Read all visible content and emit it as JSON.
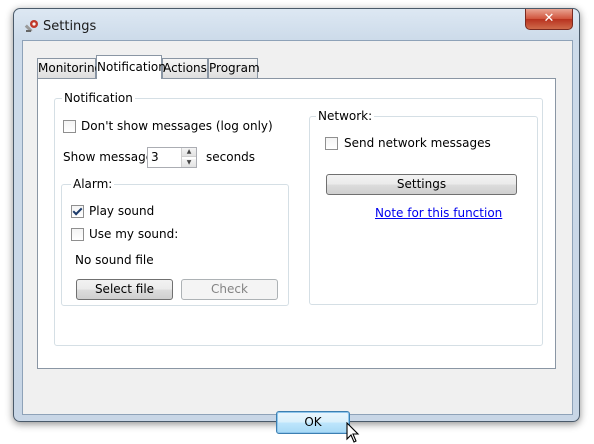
{
  "window": {
    "title": "Settings",
    "close_glyph": "✕"
  },
  "tabs": [
    {
      "label": "Monitoring",
      "active": false
    },
    {
      "label": "Notification",
      "active": true
    },
    {
      "label": "Actions",
      "active": false
    },
    {
      "label": "Program",
      "active": false
    }
  ],
  "notification": {
    "group_label": "Notification",
    "dont_show": {
      "label": "Don't show messages (log only)",
      "checked": false
    },
    "show_message": {
      "label": "Show message:",
      "value": "3",
      "unit": "seconds"
    },
    "alarm": {
      "group_label": "Alarm:",
      "play_sound": {
        "label": "Play sound",
        "checked": true
      },
      "use_my_sound": {
        "label": "Use my sound:",
        "checked": false
      },
      "sound_file_text": "No sound file",
      "select_file_button": "Select file",
      "check_button": "Check"
    },
    "network": {
      "group_label": "Network:",
      "send_network": {
        "label": "Send network messages",
        "checked": false
      },
      "settings_button": "Settings",
      "note_link": "Note for this function"
    }
  },
  "footer": {
    "ok_button": "OK"
  },
  "icons": {
    "app": "settings-tools-icon",
    "close": "close-icon",
    "cursor": "mouse-pointer-icon"
  },
  "colors": {
    "link": "#0000ee",
    "ok_accent": "#3c7fb1",
    "close_red": "#c8442e"
  }
}
